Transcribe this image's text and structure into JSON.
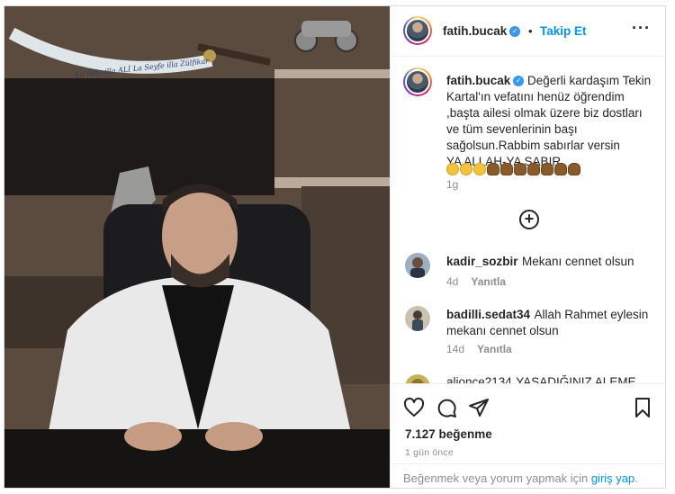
{
  "post": {
    "author": "fatih.bucak",
    "separator": "•",
    "follow_label": "Takip Et",
    "more_icon": "more-options-icon",
    "caption_lines": [
      "Değerli kardaşım Tekin",
      "Kartal'ın vefatını henüz öğrendim",
      ",başta ailesi olmak üzere biz dostları",
      "ve tüm sevenlerinin başı",
      "sağolsun.Rabbim sabırlar versin",
      "YA ALLAH-YA SABIR"
    ],
    "caption_emojis": [
      "sad-face",
      "sad-face",
      "sad-face",
      "praying-hands",
      "praying-hands",
      "praying-hands",
      "praying-hands",
      "praying-hands",
      "praying-hands",
      "praying-hands"
    ],
    "caption_time": "1g",
    "load_more_icon": "plus-circle-icon"
  },
  "photo": {
    "sword_inscription": "La Feta illa ALİ La Seyfe illa Zülfikar"
  },
  "comments": [
    {
      "user": "kadir_sozbir",
      "text": "Mekanı cennet olsun",
      "time": "4d",
      "reply": "Yanıtla"
    },
    {
      "user": "badilli.sedat34",
      "text": "Allah Rahmet eylesin mekanı cennet olsun",
      "time": "14d",
      "reply": "Yanıtla"
    },
    {
      "user": "alionce2134",
      "text": "YAŞADIĞINIZ ALEME"
    }
  ],
  "actions": {
    "icons": [
      "heart-icon",
      "comment-icon",
      "share-icon",
      "bookmark-icon"
    ],
    "likes": "7.127 beğenme",
    "posted_ago": "1 gün önce"
  },
  "login_prompt": {
    "text": "Beğenmek veya yorum yapmak için",
    "link": "giriş yap",
    "suffix": "."
  },
  "colors": {
    "link_blue": "#0095f6",
    "verified_blue": "#3897f0",
    "muted": "#8e8e8e",
    "border": "#dbdbdb"
  }
}
